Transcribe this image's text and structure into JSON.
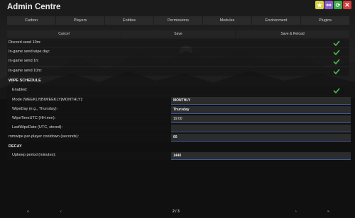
{
  "window": {
    "title": "Admin Centre"
  },
  "titlebar_buttons": [
    {
      "icon": "star-icon",
      "color": "#d8d24a"
    },
    {
      "icon": "link-icon",
      "color": "#8b5cc9"
    },
    {
      "icon": "refresh-icon",
      "color": "#3aa84a"
    },
    {
      "icon": "close-icon",
      "color": "#d63b3b"
    }
  ],
  "tabs": [
    "Carbon",
    "Players",
    "Entities",
    "Permissions",
    "Modules",
    "Environment",
    "Plugins"
  ],
  "actions": {
    "cancel": "Cancel",
    "save": "Save",
    "save_reload": "Save & Reload"
  },
  "settings": {
    "discord_send_10m": {
      "label": "Discord send 10m:",
      "checked": true
    },
    "ingame_send_wipe_day": {
      "label": "In-game send wipe day:",
      "checked": true
    },
    "ingame_send_1h": {
      "label": "In-game send 1h:",
      "checked": true
    },
    "ingame_send_10m": {
      "label": "In-game send 10m:",
      "checked": true
    }
  },
  "wipe_schedule": {
    "heading": "WIPE SCHEDULE",
    "enabled": {
      "label": "Enabled:",
      "checked": true
    },
    "mode": {
      "label": "Mode (WEEKLY|BIWEEKLY|MONTHLY):",
      "value": "MONTHLY"
    },
    "wipe_day": {
      "label": "WipeDay (e.g., Thursday):",
      "value": "Thursday"
    },
    "wipe_time": {
      "label": "WipeTimeUTC (HH:mm):",
      "value": "19:00"
    },
    "last_wipe": {
      "label": "LastWipeDate (UTC, stored):",
      "value": ""
    },
    "cooldown": {
      "label": "rnmwipe per-player cooldown (seconds):",
      "value": "60"
    }
  },
  "decay": {
    "heading": "DECAY",
    "upkeep": {
      "label": "Upkeep period (minutes):",
      "value": "1440"
    }
  },
  "footer": {
    "first": "«",
    "prev": "‹",
    "page": "2 / 3",
    "next": "›",
    "last": "»"
  },
  "colors": {
    "check": "#4fb84f",
    "field_underline": "#3b5a9a"
  }
}
